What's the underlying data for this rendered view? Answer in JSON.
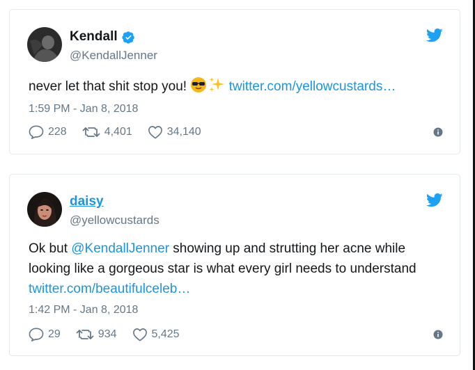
{
  "tweets": [
    {
      "name": "Kendall",
      "handle": "@KendallJenner",
      "verified": true,
      "text_before": "never let that shit stop you! ",
      "link": "twitter.com/yellowcustards…",
      "emojis": [
        "sunglasses-emoji",
        "sparkles-emoji"
      ],
      "timestamp": "1:59 PM - Jan 8, 2018",
      "replies": "228",
      "retweets": "4,401",
      "likes": "34,140"
    },
    {
      "name": "daisy",
      "handle": "@yellowcustards",
      "verified": false,
      "text_part1": "Ok but ",
      "mention": "@KendallJenner",
      "text_part2": " showing up and strutting her acne while looking like a gorgeous star is what every girl needs to understand ",
      "link": "twitter.com/beautifulceleb…",
      "timestamp": "1:42 PM - Jan 8, 2018",
      "replies": "29",
      "retweets": "934",
      "likes": "5,425"
    }
  ],
  "colors": {
    "link": "#1b95e0",
    "muted": "#657786",
    "border": "#e1e8ed"
  },
  "icons": [
    "twitter-bird-icon",
    "verified-badge-icon",
    "reply-icon",
    "retweet-icon",
    "like-icon",
    "info-icon"
  ]
}
